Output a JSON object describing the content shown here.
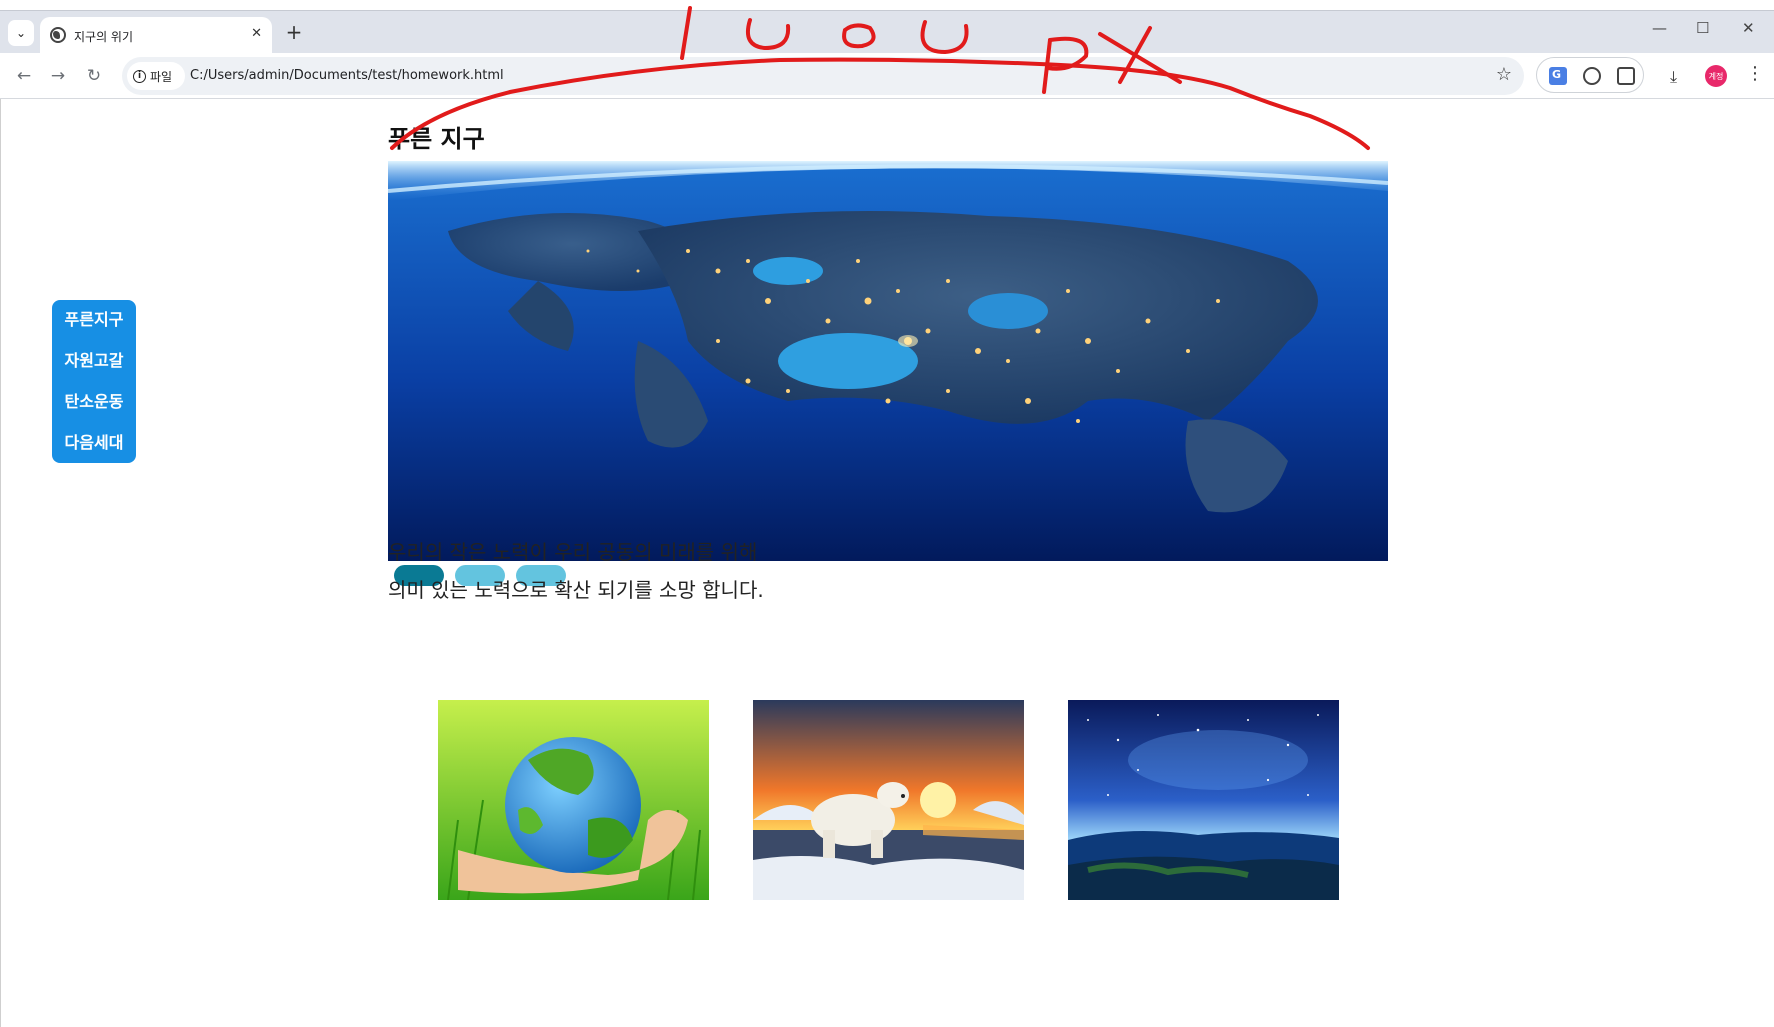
{
  "browser": {
    "tab_title": "지구의 위기",
    "tab_close": "✕",
    "new_tab": "+",
    "site_chip_label": "파일",
    "url": "C:/Users/admin/Documents/test/homework.html",
    "profile_label": "계정",
    "window_minimize": "—",
    "window_maximize": "☐",
    "window_close": "✕"
  },
  "annotation": {
    "handwritten_text": "1000px",
    "stroke_color": "#e11b1b"
  },
  "page": {
    "heading": "푸른 지구",
    "side_nav": {
      "items": [
        {
          "label": "푸른지구"
        },
        {
          "label": "자원고갈"
        },
        {
          "label": "탄소운동"
        },
        {
          "label": "다음세대"
        }
      ],
      "color": "#178fe4"
    },
    "slider": {
      "active_index": 0,
      "count": 3,
      "active_color": "#0a7a94",
      "inactive_color": "#63c4df"
    },
    "paragraph": {
      "line1": "우리의 작은 노력이 우리 공동의 미래를 위해",
      "line2": "의미 있는 노력으로 확산 되기를 소망 합니다."
    },
    "images": [
      {
        "name": "hero-earth-night-europe-image"
      },
      {
        "name": "hand-holding-green-globe-image"
      },
      {
        "name": "polar-bear-sunset-ice-image"
      },
      {
        "name": "starry-sky-horizon-image"
      }
    ]
  }
}
